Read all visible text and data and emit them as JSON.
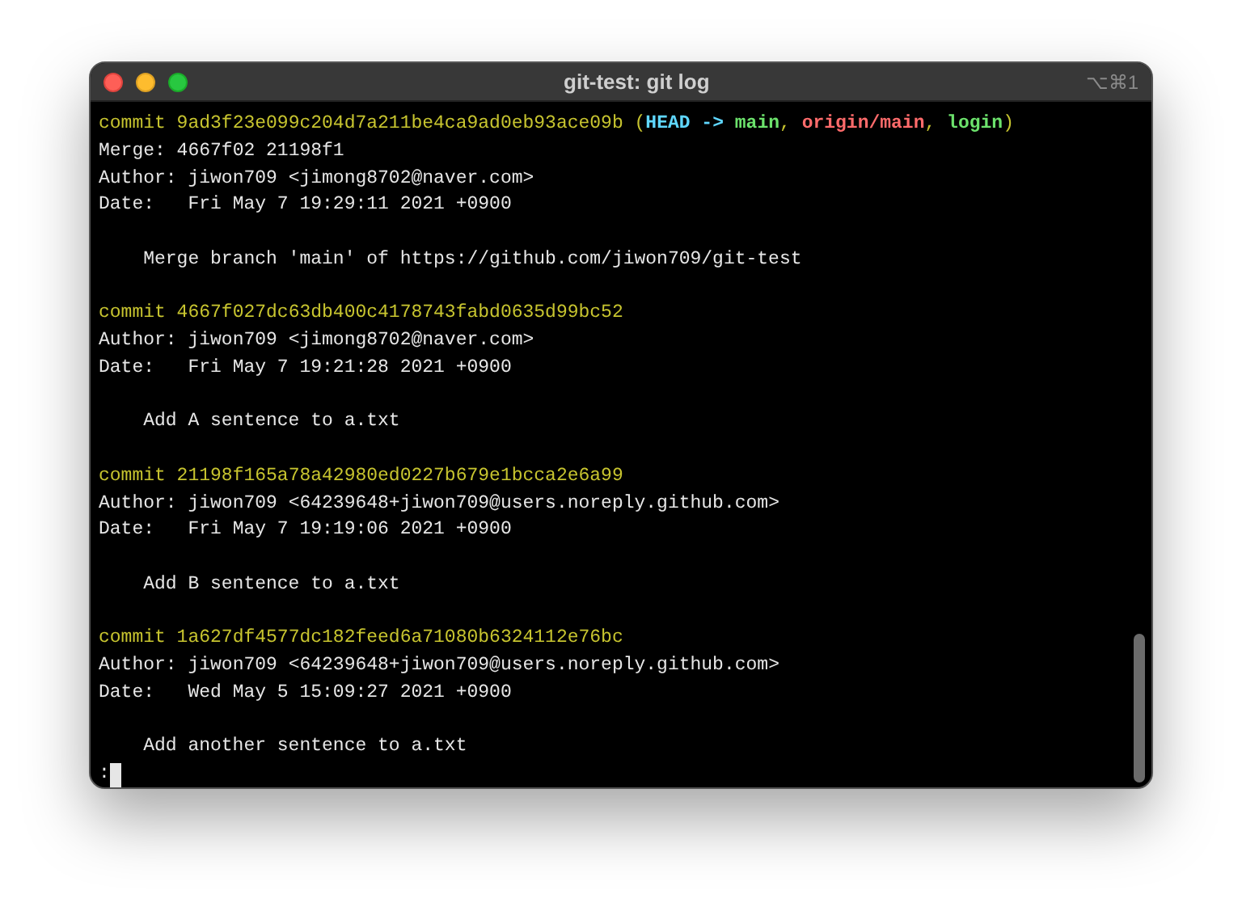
{
  "window": {
    "title": "git-test: git log",
    "shortcut": "⌥⌘1"
  },
  "commits": [
    {
      "commit": "commit 9ad3f23e099c204d7a211be4ca9ad0eb93ace09b",
      "decoration": [
        {
          "kind": "punct",
          "text": " ("
        },
        {
          "kind": "head",
          "text": "HEAD -> "
        },
        {
          "kind": "local",
          "text": "main"
        },
        {
          "kind": "punct",
          "text": ", "
        },
        {
          "kind": "remote",
          "text": "origin/main"
        },
        {
          "kind": "punct",
          "text": ", "
        },
        {
          "kind": "local",
          "text": "login"
        },
        {
          "kind": "punct",
          "text": ")"
        }
      ],
      "merge": "Merge: 4667f02 21198f1",
      "author": "Author: jiwon709 <jimong8702@naver.com>",
      "date": "Date:   Fri May 7 19:29:11 2021 +0900",
      "message": "Merge branch 'main' of https://github.com/jiwon709/git-test"
    },
    {
      "commit": "commit 4667f027dc63db400c4178743fabd0635d99bc52",
      "author": "Author: jiwon709 <jimong8702@naver.com>",
      "date": "Date:   Fri May 7 19:21:28 2021 +0900",
      "message": "Add A sentence to a.txt"
    },
    {
      "commit": "commit 21198f165a78a42980ed0227b679e1bcca2e6a99",
      "author": "Author: jiwon709 <64239648+jiwon709@users.noreply.github.com>",
      "date": "Date:   Fri May 7 19:19:06 2021 +0900",
      "message": "Add B sentence to a.txt"
    },
    {
      "commit": "commit 1a627df4577dc182feed6a71080b6324112e76bc",
      "author": "Author: jiwon709 <64239648+jiwon709@users.noreply.github.com>",
      "date": "Date:   Wed May 5 15:09:27 2021 +0900",
      "message": "Add another sentence to a.txt"
    }
  ],
  "prompt": ":"
}
